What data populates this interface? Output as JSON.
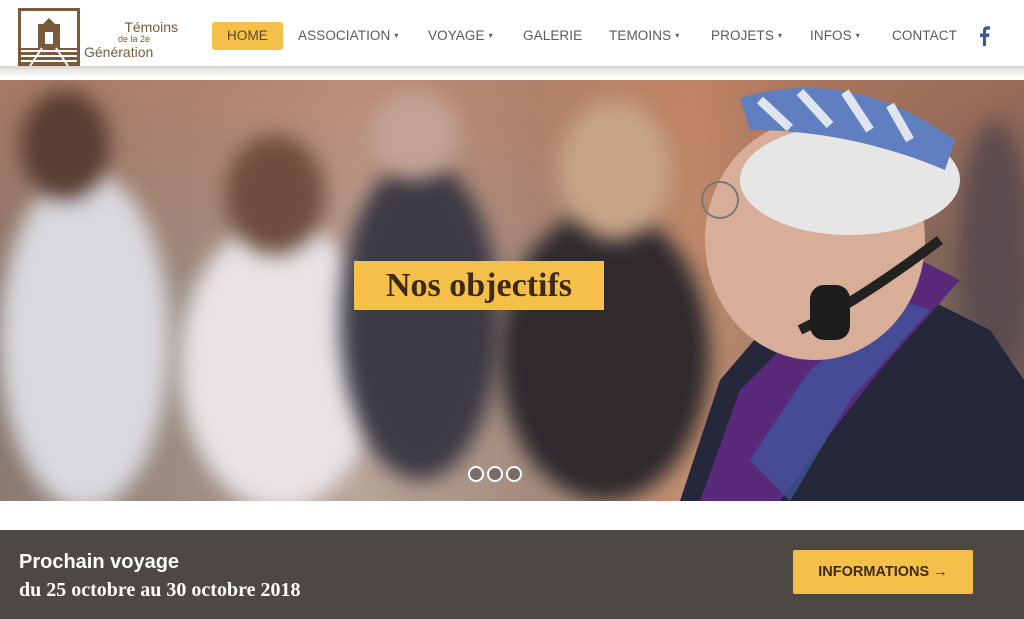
{
  "logo": {
    "line1": "Témoins",
    "line2": "de la 2e",
    "line3": "Génération",
    "color": "#7a5a3a"
  },
  "nav": {
    "items": [
      {
        "label": "HOME",
        "active": true,
        "dropdown": false
      },
      {
        "label": "ASSOCIATION",
        "active": false,
        "dropdown": true
      },
      {
        "label": "VOYAGE",
        "active": false,
        "dropdown": true
      },
      {
        "label": "GALERIE",
        "active": false,
        "dropdown": false
      },
      {
        "label": "TEMOINS",
        "active": false,
        "dropdown": true
      },
      {
        "label": "PROJETS",
        "active": false,
        "dropdown": true
      },
      {
        "label": "INFOS",
        "active": false,
        "dropdown": true
      },
      {
        "label": "CONTACT",
        "active": false,
        "dropdown": false
      }
    ],
    "caret_glyph": "▾",
    "social_icon": "facebook-icon",
    "accent_color": "#f5c04a"
  },
  "hero": {
    "slide_title": "Nos objectifs",
    "slide_count": 3,
    "active_slide": 1
  },
  "banner": {
    "label": "Prochain voyage",
    "dates": "du 25 octobre au 30 octobre 2018",
    "button_label": "INFORMATIONS →",
    "background": "#4d4844"
  }
}
